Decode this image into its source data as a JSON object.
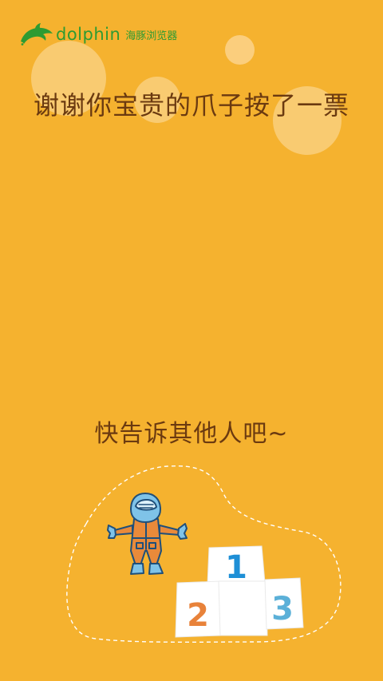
{
  "brand": {
    "name": "dolphin",
    "name_cn": "海豚浏览器",
    "color": "#2E9B32",
    "logo_icon": "dolphin-logo-icon"
  },
  "headline": "谢谢你宝贵的爪子按了一票",
  "subline": "快告诉其他人吧~",
  "background_color": "#F5B22F",
  "text_color": "#6B3A10",
  "podium": {
    "first": "1",
    "second": "2",
    "third": "3",
    "colors": {
      "first": "#1E8FD6",
      "second": "#E8823A",
      "third": "#5BB0D8"
    }
  }
}
